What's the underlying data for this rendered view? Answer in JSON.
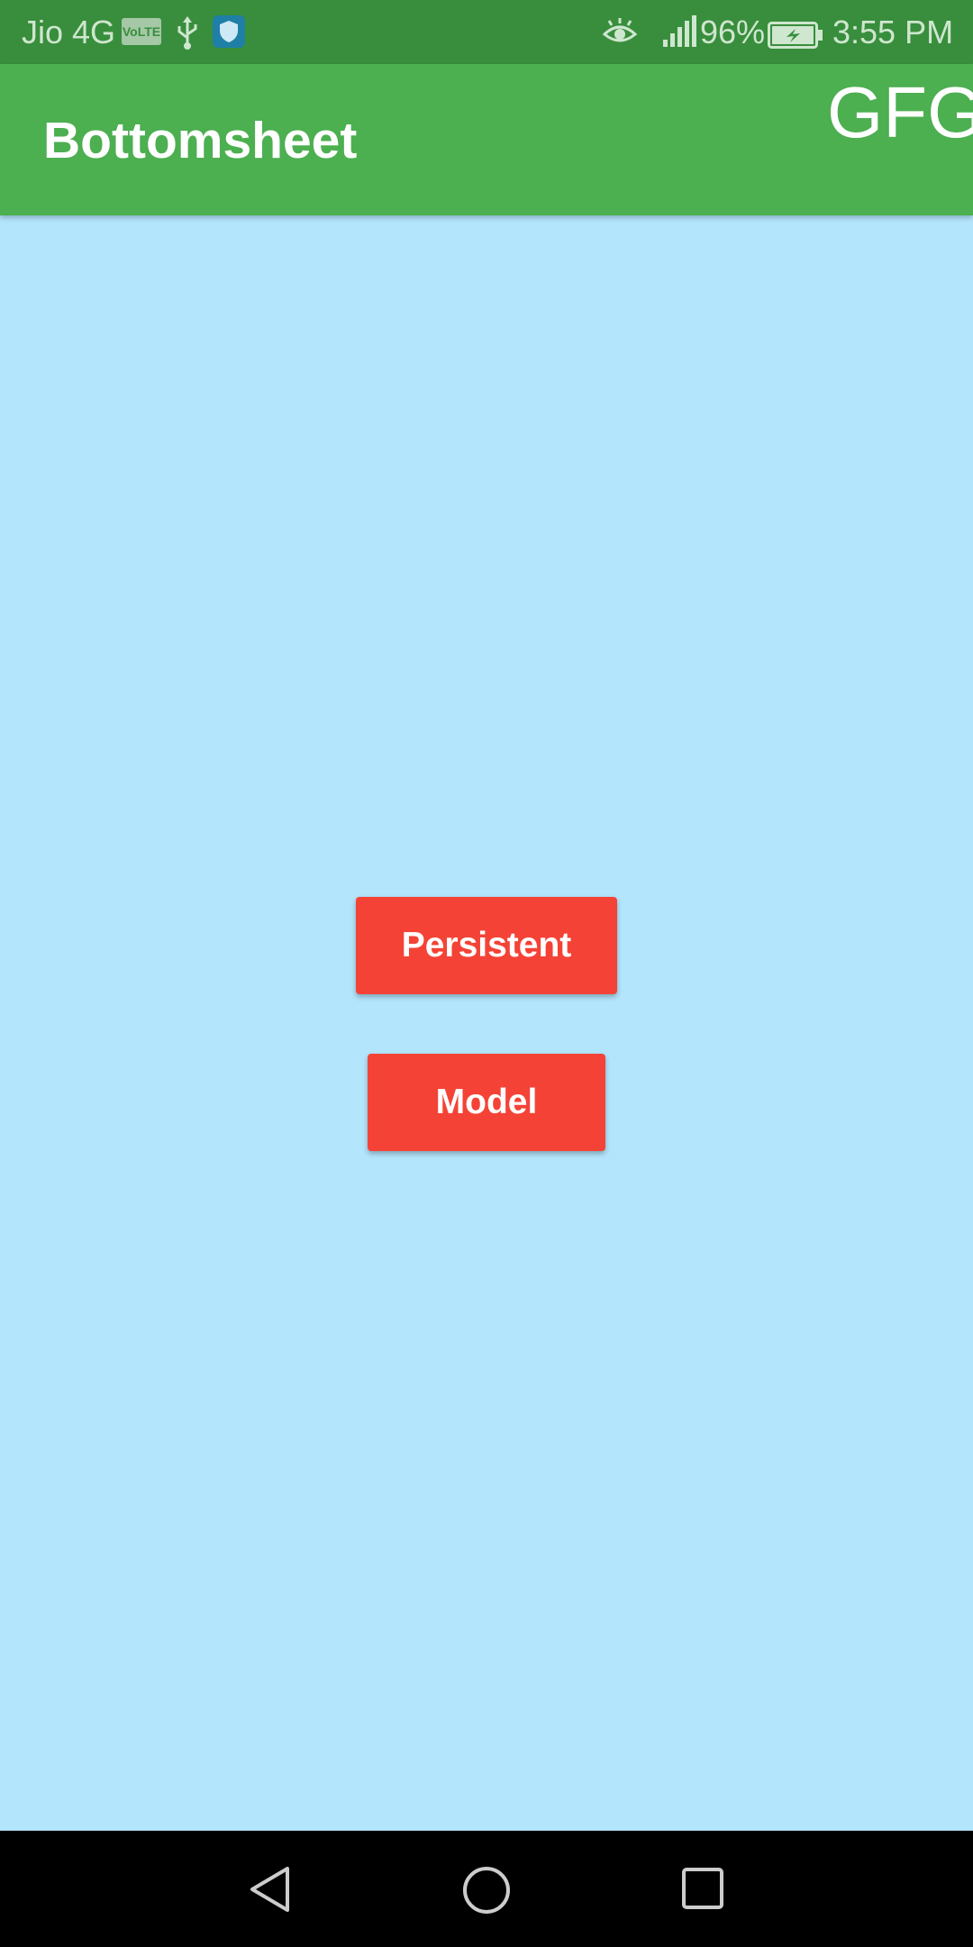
{
  "status_bar": {
    "carrier": "Jio 4G",
    "volte": "VoLTE",
    "icons": [
      "usb-icon",
      "shield-icon",
      "eye-icon",
      "signal-icon",
      "battery-charging-icon"
    ],
    "battery_percent": "96%",
    "time": "3:55 PM"
  },
  "app_bar": {
    "title": "Bottomsheet",
    "action": "GFG"
  },
  "buttons": {
    "persistent_label": "Persistent",
    "model_label": "Model"
  },
  "navigation": {
    "icons": [
      "back-icon",
      "home-icon",
      "recent-apps-icon"
    ]
  },
  "colors": {
    "status_bar": "#388e3c",
    "app_bar": "#4caf50",
    "background": "#b3e5fc",
    "button": "#f44336",
    "nav_bar": "#000000"
  }
}
